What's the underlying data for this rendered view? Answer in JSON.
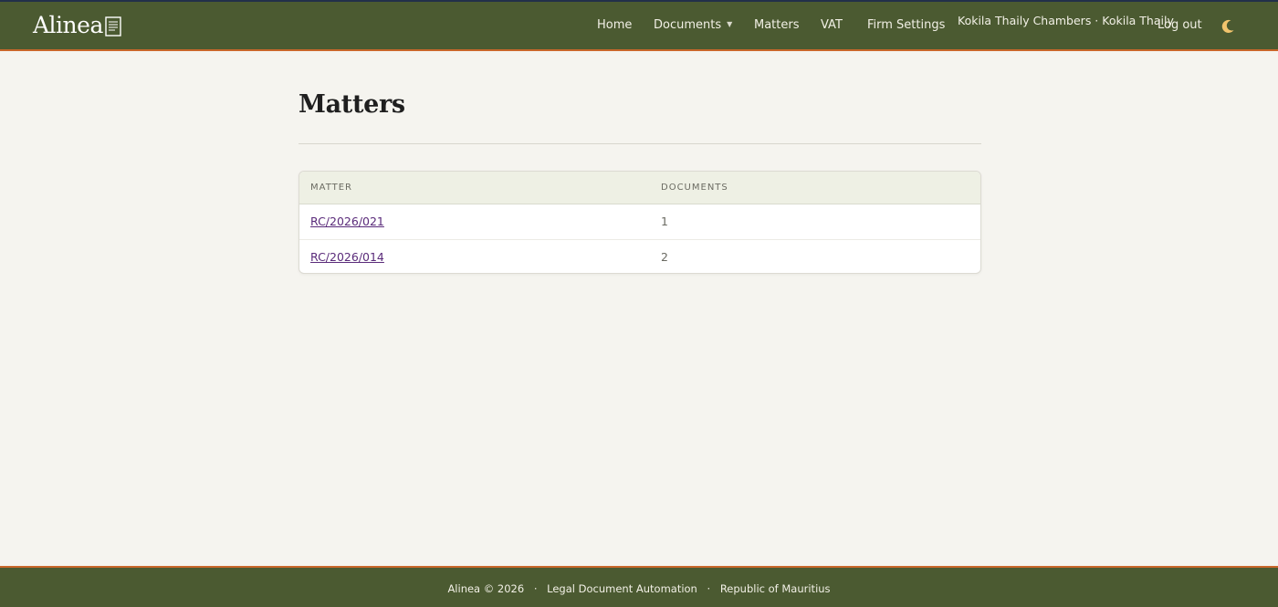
{
  "brand": {
    "name": "Alinea"
  },
  "nav": {
    "home": "Home",
    "documents": "Documents",
    "matters": "Matters",
    "vat": "VAT",
    "firm_settings": "Firm Settings",
    "user": "Kokila Thaily Chambers · Kokila Thaily",
    "logout": "Log out",
    "theme_icon": "moon-icon"
  },
  "page": {
    "title": "Matters"
  },
  "table": {
    "headers": [
      "Matter",
      "Documents"
    ],
    "rows": [
      {
        "matter": "RC/2026/021",
        "documents": "1"
      },
      {
        "matter": "RC/2026/014",
        "documents": "2"
      }
    ]
  },
  "footer": {
    "copyright": "Alinea © 2026",
    "tagline": "Legal Document Automation",
    "jurisdiction": "Republic of Mauritius",
    "separator": "·"
  },
  "colors": {
    "header_bg": "#4b5a31",
    "accent": "#c9672a",
    "link": "#5a2b7a",
    "page_bg": "#f5f4ef"
  }
}
